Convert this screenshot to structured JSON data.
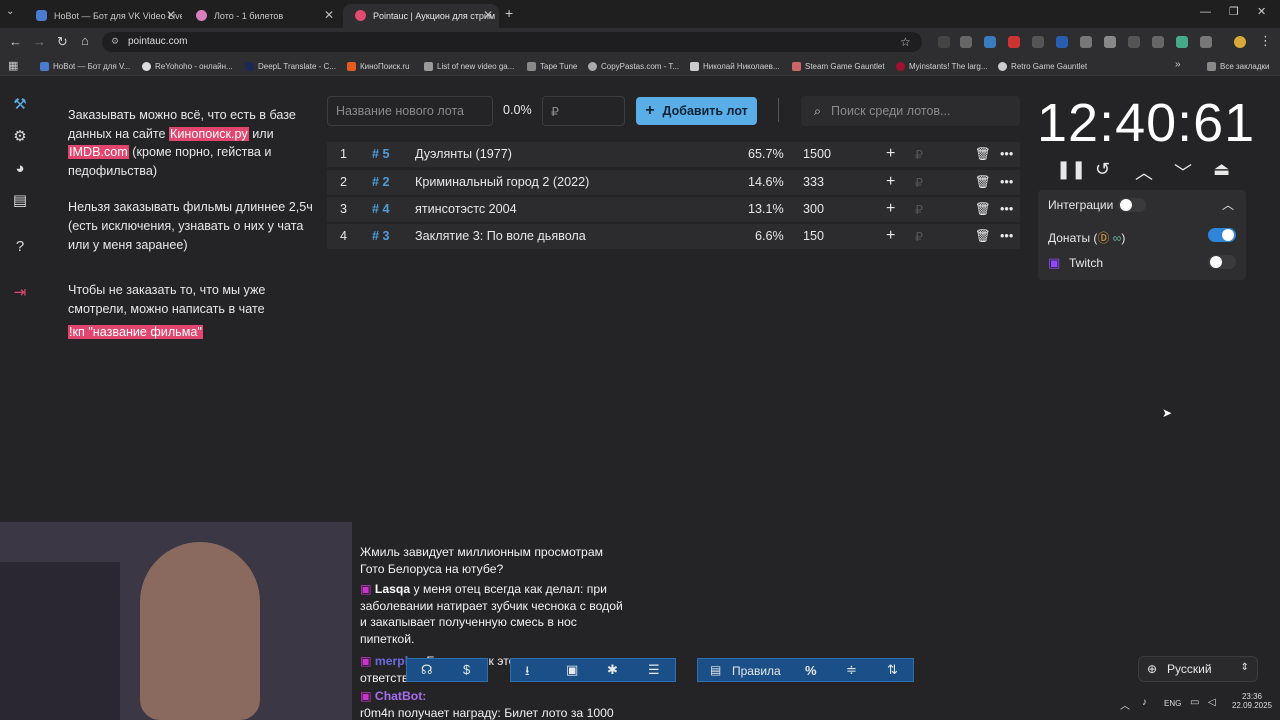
{
  "browser": {
    "tabs": [
      {
        "title": "HoBot — Бот для VK Video Live"
      },
      {
        "title": "Лото - 1 билетов"
      },
      {
        "title": "Pointauc | Аукцион для стрим"
      }
    ],
    "url": "pointauc.com",
    "bookmarks": [
      "HoBot — Бот для V...",
      "ReYohoho - онлайн...",
      "DeepL Translate - С...",
      "КиноПоиск.ru",
      "List of new video ga...",
      "Tape Tune",
      "CopyPastas.com - T...",
      "Николай Николаев...",
      "Steam Game Gauntlet",
      "Myinstants! The larg...",
      "Retro Game Gauntlet"
    ],
    "all_bookmarks": "Все закладки"
  },
  "rules": {
    "p1_a": "Заказывать можно всё, что есть в базе данных на сайте ",
    "p1_link1": "Кинопоиск.ру",
    "p1_b": " или ",
    "p1_link2": "IMDB.com",
    "p1_c": " (кроме порно, гейства и педофильства)",
    "p2": "Нельзя заказывать фильмы длиннее 2,5ч (есть исключения, узнавать о них у чата или у меня заранее)",
    "p3": "Чтобы не заказать то, что мы уже смотрели, можно написать в чате",
    "p3_cmd": "!кп \"название фильма\""
  },
  "lot_form": {
    "name_placeholder": "Название нового лота",
    "percent": "0.0%",
    "amount_placeholder": "₽",
    "add_label": "Добавить лот",
    "search_placeholder": "Поиск среди лотов..."
  },
  "lots": [
    {
      "pos": "1",
      "id": "# 5",
      "name": "Дуэлянты (1977)",
      "pct": "65.7%",
      "amount": "1500"
    },
    {
      "pos": "2",
      "id": "# 2",
      "name": "Криминальный город 2 (2022)",
      "pct": "14.6%",
      "amount": "333"
    },
    {
      "pos": "3",
      "id": "# 4",
      "name": "ятинсотэстс 2004",
      "pct": "13.1%",
      "amount": "300"
    },
    {
      "pos": "4",
      "id": "# 3",
      "name": "Заклятие 3: По воле дьявола",
      "pct": "6.6%",
      "amount": "150"
    }
  ],
  "timer": {
    "display": "12:40:61"
  },
  "integrations": {
    "title": "Интеграции",
    "donations_label": "Донаты (",
    "donations_suffix": ")",
    "twitch_label": "Twitch",
    "donations_enabled": true,
    "twitch_enabled": false
  },
  "chat": [
    {
      "user": "",
      "text": "Жмиль завидует миллионным просмотрам Гото Белоруса на ютубе?"
    },
    {
      "user": "Lasqa",
      "text": "у меня отец всегда как делал: при заболевании натирает зубчик чеснока с водой и закапывает полученную смесь в нос пипеткой."
    },
    {
      "user": "merphy:",
      "text": "Есть чеснок это очень ответственно"
    },
    {
      "user": "ChatBot:",
      "text": "r0m4n получает награду: Билет лото за 1000"
    }
  ],
  "bottom": {
    "rules_label": "Правила",
    "percent_symbol": "%"
  },
  "language": {
    "selected": "Русский"
  },
  "taskbar": {
    "lang": "ENG",
    "time": "23:36",
    "date": "22.09.2025"
  },
  "colors": {
    "accent": "#5aaee8",
    "pink": "#e2466f",
    "hash": "#4f9bd8"
  }
}
